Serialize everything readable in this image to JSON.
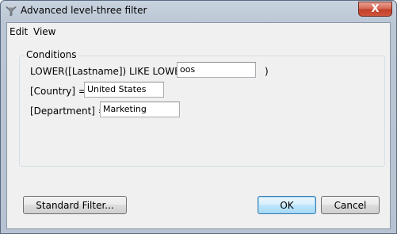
{
  "window": {
    "title": "Advanced level-three filter",
    "close_symbol": "X"
  },
  "menu": {
    "items": [
      {
        "label": "Edit"
      },
      {
        "label": "View"
      }
    ]
  },
  "conditions": {
    "legend": "Conditions",
    "rows": [
      {
        "label": "LOWER([Lastname]) LIKE LOWER(",
        "value": "oos",
        "suffix": ")"
      },
      {
        "label": "[Country]  =",
        "value": "United States"
      },
      {
        "label": "[Department]  =",
        "value": "Marketing"
      }
    ]
  },
  "buttons": {
    "standard_filter": "Standard Filter...",
    "ok": "OK",
    "cancel": "Cancel"
  },
  "icons": {
    "app": "filter-funnel-icon",
    "close": "close-icon"
  }
}
